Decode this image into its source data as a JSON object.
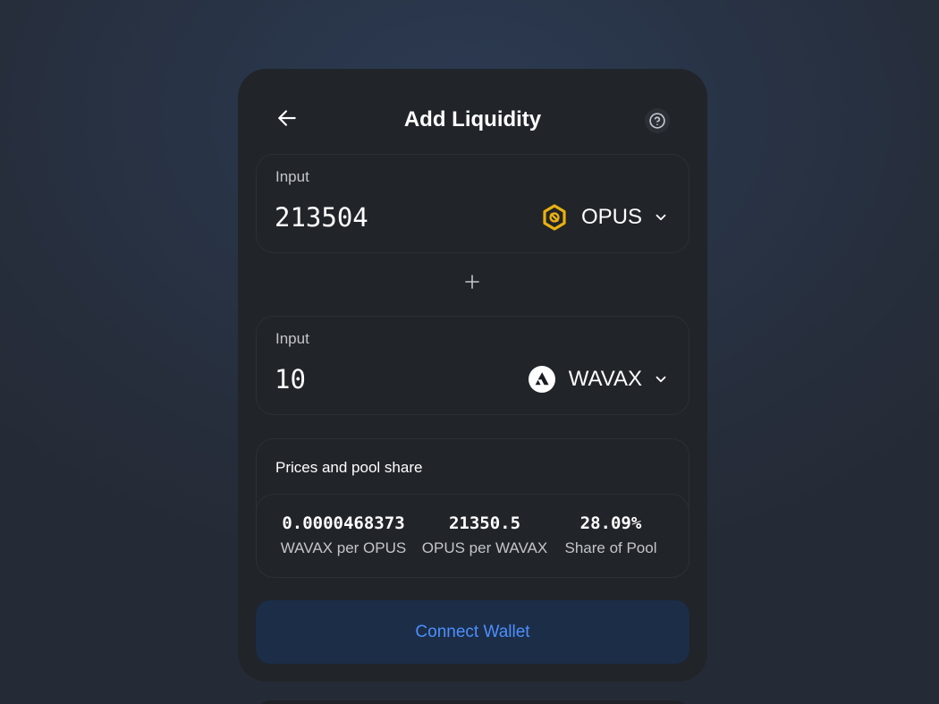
{
  "header": {
    "title": "Add Liquidity",
    "back_icon": "arrow-left-icon",
    "help_icon": "question-circle-icon"
  },
  "inputs": [
    {
      "label": "Input",
      "value": "213504",
      "token": {
        "symbol": "OPUS",
        "icon": "opus-hexagon-icon",
        "color": "#e8b10f"
      }
    },
    {
      "label": "Input",
      "value": "10",
      "token": {
        "symbol": "WAVAX",
        "icon": "avax-icon",
        "color": "#ffffff"
      }
    }
  ],
  "separator_icon": "plus-icon",
  "prices": {
    "title": "Prices and pool share",
    "stats": [
      {
        "value": "0.0000468373",
        "label": "WAVAX per OPUS"
      },
      {
        "value": "21350.5",
        "label": "OPUS per WAVAX"
      },
      {
        "value": "28.09%",
        "label": "Share of Pool"
      }
    ]
  },
  "action": {
    "label": "Connect Wallet",
    "color": "#4c8ffe"
  },
  "colors": {
    "card_bg": "#212429",
    "panel_border": "#2c2f36",
    "button_bg": "#1c2d47",
    "muted_text": "#c3c5cb"
  }
}
